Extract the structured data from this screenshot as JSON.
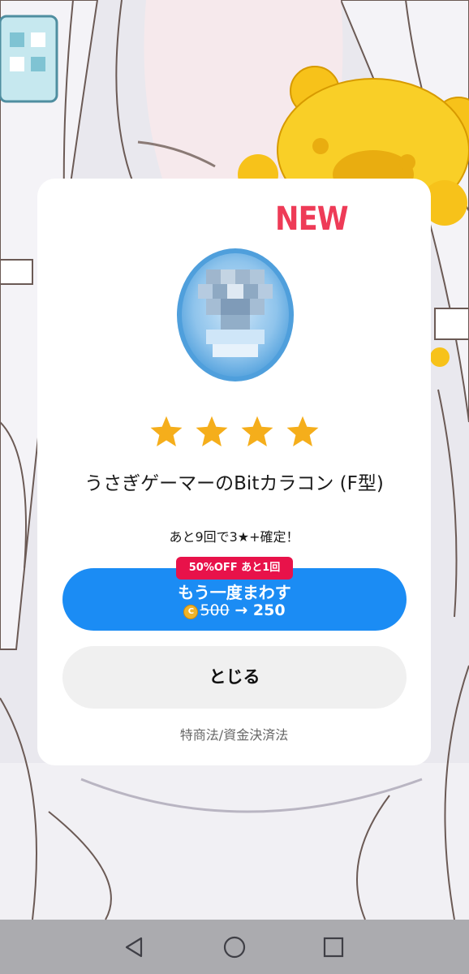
{
  "modal": {
    "new_badge": "NEW",
    "rarity_stars": 4,
    "item_name": "うさぎゲーマーのBitカラコン (F型)",
    "guarantee_notice": "あと9回で3★+確定！",
    "discount_badge": "50%OFF あと1回",
    "spin_again_label": "もう一度まわす",
    "original_price": "500",
    "arrow": "→",
    "discounted_price": "250",
    "close_label": "とじる",
    "legal_link": "特商法/資金決済法"
  },
  "colors": {
    "accent_blue": "#1b8cf4",
    "badge_red": "#e8124a",
    "new_red": "#ee3b57",
    "star_yellow": "#f5ae1b"
  },
  "navbar": {
    "buttons": [
      "back-icon",
      "home-icon",
      "recents-icon"
    ]
  }
}
